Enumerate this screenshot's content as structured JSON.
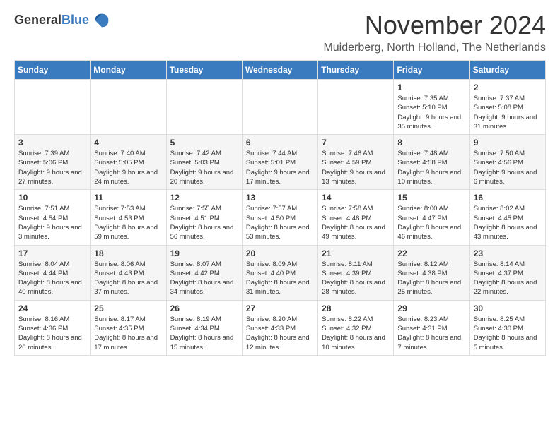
{
  "logo": {
    "general": "General",
    "blue": "Blue"
  },
  "title": "November 2024",
  "location": "Muiderberg, North Holland, The Netherlands",
  "days_of_week": [
    "Sunday",
    "Monday",
    "Tuesday",
    "Wednesday",
    "Thursday",
    "Friday",
    "Saturday"
  ],
  "weeks": [
    [
      {
        "day": "",
        "info": ""
      },
      {
        "day": "",
        "info": ""
      },
      {
        "day": "",
        "info": ""
      },
      {
        "day": "",
        "info": ""
      },
      {
        "day": "",
        "info": ""
      },
      {
        "day": "1",
        "info": "Sunrise: 7:35 AM\nSunset: 5:10 PM\nDaylight: 9 hours and 35 minutes."
      },
      {
        "day": "2",
        "info": "Sunrise: 7:37 AM\nSunset: 5:08 PM\nDaylight: 9 hours and 31 minutes."
      }
    ],
    [
      {
        "day": "3",
        "info": "Sunrise: 7:39 AM\nSunset: 5:06 PM\nDaylight: 9 hours and 27 minutes."
      },
      {
        "day": "4",
        "info": "Sunrise: 7:40 AM\nSunset: 5:05 PM\nDaylight: 9 hours and 24 minutes."
      },
      {
        "day": "5",
        "info": "Sunrise: 7:42 AM\nSunset: 5:03 PM\nDaylight: 9 hours and 20 minutes."
      },
      {
        "day": "6",
        "info": "Sunrise: 7:44 AM\nSunset: 5:01 PM\nDaylight: 9 hours and 17 minutes."
      },
      {
        "day": "7",
        "info": "Sunrise: 7:46 AM\nSunset: 4:59 PM\nDaylight: 9 hours and 13 minutes."
      },
      {
        "day": "8",
        "info": "Sunrise: 7:48 AM\nSunset: 4:58 PM\nDaylight: 9 hours and 10 minutes."
      },
      {
        "day": "9",
        "info": "Sunrise: 7:50 AM\nSunset: 4:56 PM\nDaylight: 9 hours and 6 minutes."
      }
    ],
    [
      {
        "day": "10",
        "info": "Sunrise: 7:51 AM\nSunset: 4:54 PM\nDaylight: 9 hours and 3 minutes."
      },
      {
        "day": "11",
        "info": "Sunrise: 7:53 AM\nSunset: 4:53 PM\nDaylight: 8 hours and 59 minutes."
      },
      {
        "day": "12",
        "info": "Sunrise: 7:55 AM\nSunset: 4:51 PM\nDaylight: 8 hours and 56 minutes."
      },
      {
        "day": "13",
        "info": "Sunrise: 7:57 AM\nSunset: 4:50 PM\nDaylight: 8 hours and 53 minutes."
      },
      {
        "day": "14",
        "info": "Sunrise: 7:58 AM\nSunset: 4:48 PM\nDaylight: 8 hours and 49 minutes."
      },
      {
        "day": "15",
        "info": "Sunrise: 8:00 AM\nSunset: 4:47 PM\nDaylight: 8 hours and 46 minutes."
      },
      {
        "day": "16",
        "info": "Sunrise: 8:02 AM\nSunset: 4:45 PM\nDaylight: 8 hours and 43 minutes."
      }
    ],
    [
      {
        "day": "17",
        "info": "Sunrise: 8:04 AM\nSunset: 4:44 PM\nDaylight: 8 hours and 40 minutes."
      },
      {
        "day": "18",
        "info": "Sunrise: 8:06 AM\nSunset: 4:43 PM\nDaylight: 8 hours and 37 minutes."
      },
      {
        "day": "19",
        "info": "Sunrise: 8:07 AM\nSunset: 4:42 PM\nDaylight: 8 hours and 34 minutes."
      },
      {
        "day": "20",
        "info": "Sunrise: 8:09 AM\nSunset: 4:40 PM\nDaylight: 8 hours and 31 minutes."
      },
      {
        "day": "21",
        "info": "Sunrise: 8:11 AM\nSunset: 4:39 PM\nDaylight: 8 hours and 28 minutes."
      },
      {
        "day": "22",
        "info": "Sunrise: 8:12 AM\nSunset: 4:38 PM\nDaylight: 8 hours and 25 minutes."
      },
      {
        "day": "23",
        "info": "Sunrise: 8:14 AM\nSunset: 4:37 PM\nDaylight: 8 hours and 22 minutes."
      }
    ],
    [
      {
        "day": "24",
        "info": "Sunrise: 8:16 AM\nSunset: 4:36 PM\nDaylight: 8 hours and 20 minutes."
      },
      {
        "day": "25",
        "info": "Sunrise: 8:17 AM\nSunset: 4:35 PM\nDaylight: 8 hours and 17 minutes."
      },
      {
        "day": "26",
        "info": "Sunrise: 8:19 AM\nSunset: 4:34 PM\nDaylight: 8 hours and 15 minutes."
      },
      {
        "day": "27",
        "info": "Sunrise: 8:20 AM\nSunset: 4:33 PM\nDaylight: 8 hours and 12 minutes."
      },
      {
        "day": "28",
        "info": "Sunrise: 8:22 AM\nSunset: 4:32 PM\nDaylight: 8 hours and 10 minutes."
      },
      {
        "day": "29",
        "info": "Sunrise: 8:23 AM\nSunset: 4:31 PM\nDaylight: 8 hours and 7 minutes."
      },
      {
        "day": "30",
        "info": "Sunrise: 8:25 AM\nSunset: 4:30 PM\nDaylight: 8 hours and 5 minutes."
      }
    ]
  ]
}
